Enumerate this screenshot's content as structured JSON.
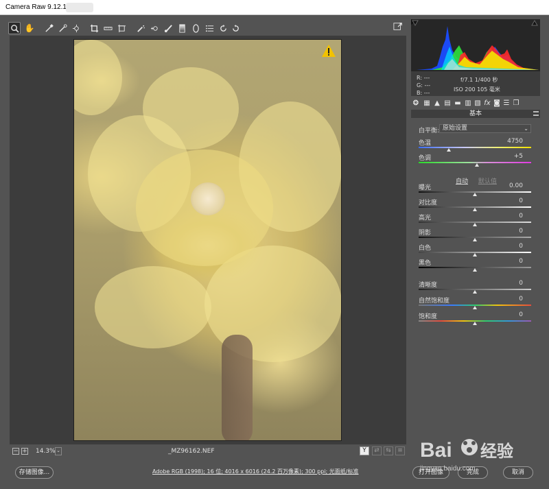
{
  "app": {
    "title": "Camera Raw 9.12.1 -"
  },
  "toolbar": {
    "tools": [
      "zoom-icon",
      "hand-icon",
      "white-balance-icon",
      "color-sampler-icon",
      "targeted-adjust-icon",
      "crop-icon",
      "straighten-icon",
      "transform-icon",
      "spot-removal-icon",
      "red-eye-icon",
      "adjustment-brush-icon",
      "graduated-filter-icon",
      "radial-filter-icon",
      "preferences-icon",
      "rotate-left-icon",
      "rotate-right-icon"
    ]
  },
  "image": {
    "filename": "_MZ96162.NEF",
    "warning": "highlight-clipping-warning"
  },
  "status": {
    "zoom": "14.3%",
    "zoom_minus": "−",
    "zoom_plus": "+",
    "dropdown": "⌄"
  },
  "view_buttons": [
    "Y",
    "⇄",
    "⇆",
    "≡"
  ],
  "footer": {
    "save_label": "存储图像...",
    "workflow_info": "Adobe RGB (1998); 16 位; 4016 x 6016 (24.2 百万像素); 300 ppi; 光面纸/标准",
    "open_label": "打开图像",
    "done_label": "完成",
    "cancel_label": "取消"
  },
  "histogram": {
    "r_label": "R:",
    "g_label": "G:",
    "b_label": "B:",
    "r_value": "---",
    "g_value": "---",
    "b_value": "---",
    "aperture_shutter": "f/7.1  1/400 秒",
    "iso_focal": "ISO 200  105 毫米"
  },
  "panel": {
    "section_title": "基本",
    "white_balance_label": "白平衡:",
    "white_balance_value": "原始设置",
    "auto_label": "自动",
    "default_label": "默认值",
    "sliders": [
      {
        "key": "temp",
        "label": "色温",
        "value": "4750",
        "position": 0.27
      },
      {
        "key": "tint",
        "label": "色调",
        "value": "+5",
        "position": 0.52
      },
      {
        "key": "exposure",
        "label": "曝光",
        "value": "0.00",
        "position": 0.5
      },
      {
        "key": "contrast",
        "label": "对比度",
        "value": "0",
        "position": 0.5
      },
      {
        "key": "highlights",
        "label": "高光",
        "value": "0",
        "position": 0.5
      },
      {
        "key": "shadows",
        "label": "阴影",
        "value": "0",
        "position": 0.5
      },
      {
        "key": "whites",
        "label": "白色",
        "value": "0",
        "position": 0.5
      },
      {
        "key": "blacks",
        "label": "黑色",
        "value": "0",
        "position": 0.5
      },
      {
        "key": "clarity",
        "label": "清晰度",
        "value": "0",
        "position": 0.5
      },
      {
        "key": "vibrance",
        "label": "自然饱和度",
        "value": "0",
        "position": 0.5
      },
      {
        "key": "saturation",
        "label": "饱和度",
        "value": "0",
        "position": 0.5
      }
    ]
  },
  "watermark": {
    "brand": "Bai",
    "brand2": "经验",
    "url": "jingyan.baidu.com"
  },
  "colors": {
    "background": "#535353",
    "panel_dark": "#3c3c3c",
    "accent_warning": "#f2c200"
  }
}
